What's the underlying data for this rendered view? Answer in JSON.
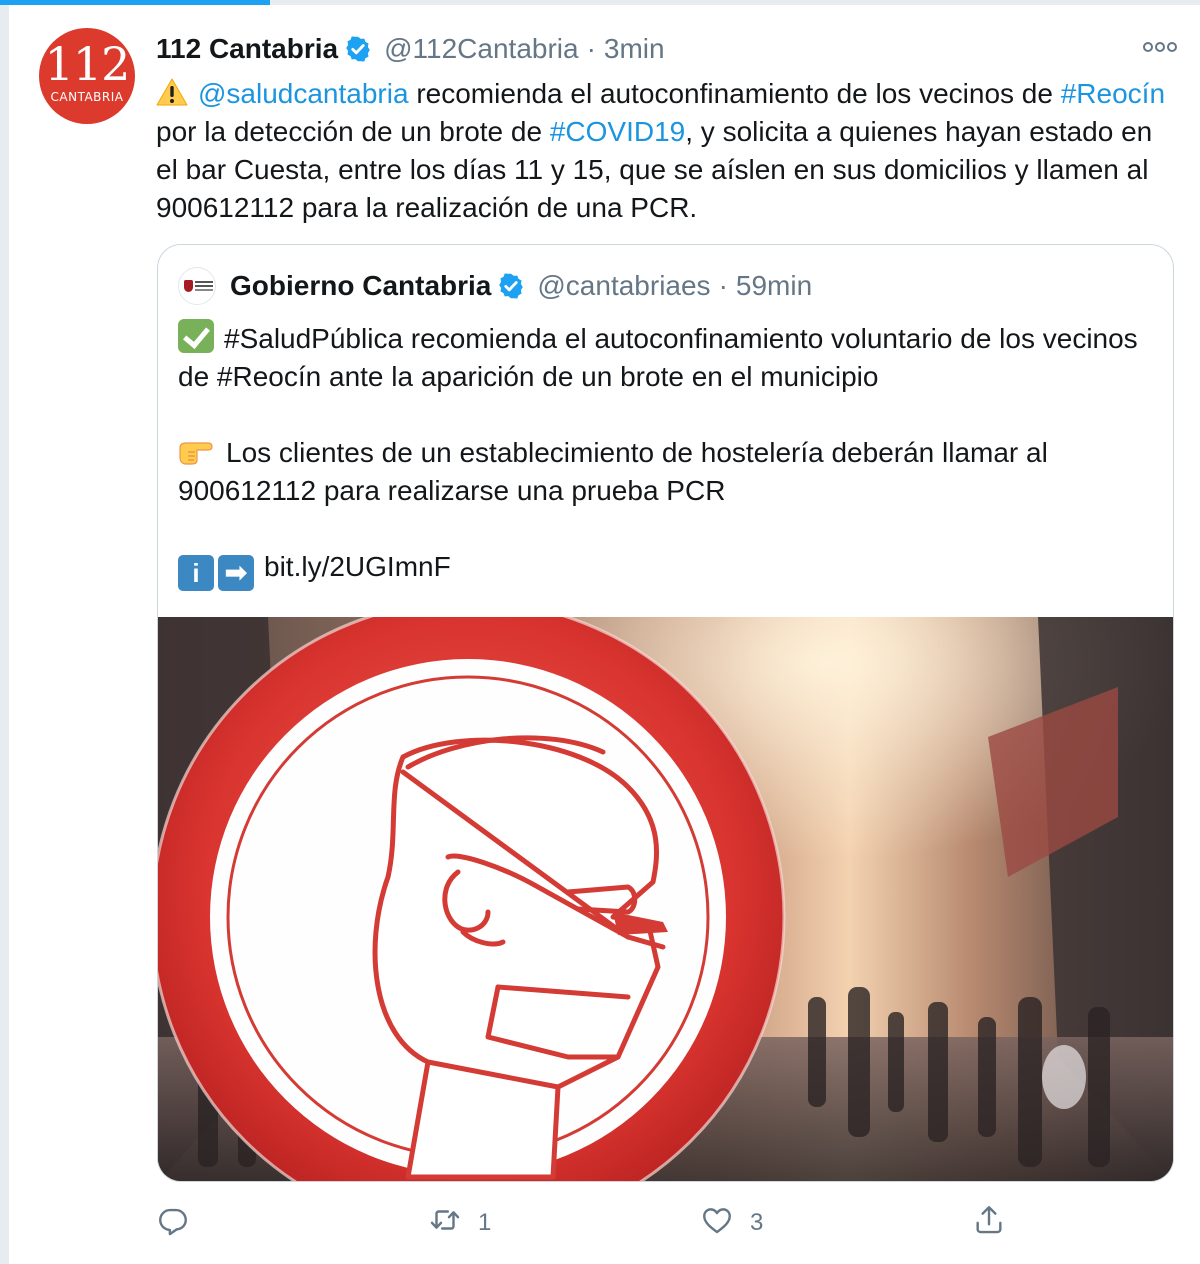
{
  "progress": {
    "fraction": 0.225,
    "color": "#1da1f2"
  },
  "tweet": {
    "avatar": {
      "icon": "112-cantabria-logo",
      "number": "112",
      "label": "CANTABRIA"
    },
    "author": {
      "name": "112 Cantabria",
      "handle": "@112Cantabria",
      "separator": "·",
      "time": "3min",
      "verified": true
    },
    "more_icon": "more-icon",
    "text": {
      "emoji": "warning",
      "mention": "@saludcantabria",
      "t1": " recomienda el autoconfinamiento de los vecinos de ",
      "hashtag1": "#Reocín",
      "t2": " por la detección de un brote de ",
      "hashtag2": "#COVID19",
      "t3": ", y solicita a quienes hayan estado en el bar Cuesta, entre los días 11 y 15, que se aíslen en sus domicilios y llamen al 900612112 para la realización de una PCR."
    },
    "quote": {
      "author": {
        "name": "Gobierno Cantabria",
        "handle": "@cantabriaes",
        "separator": "·",
        "time": "59min",
        "verified": true
      },
      "lines": {
        "p1": "#SaludPública recomienda el autoconfinamiento voluntario de los vecinos de #Reocín ante la aparición de un brote en el municipio",
        "p2": "Los clientes de un establecimiento de hostelería deberán llamar al 900612112 para realizarse una prueba PCR",
        "info_letter": "i",
        "arrow": "➡",
        "link": "bit.ly/2UGImnF"
      },
      "media": "no-mask-sign-photo"
    },
    "actions": {
      "reply": {
        "icon": "reply-icon",
        "count": ""
      },
      "retweet": {
        "icon": "retweet-icon",
        "count": "1"
      },
      "like": {
        "icon": "like-icon",
        "count": "3"
      },
      "share": {
        "icon": "share-icon",
        "count": ""
      }
    },
    "colors": {
      "link": "#1b95e0",
      "secondary": "#657786",
      "avatar": "#dc3a2c",
      "verified": "#1da1f2"
    }
  }
}
